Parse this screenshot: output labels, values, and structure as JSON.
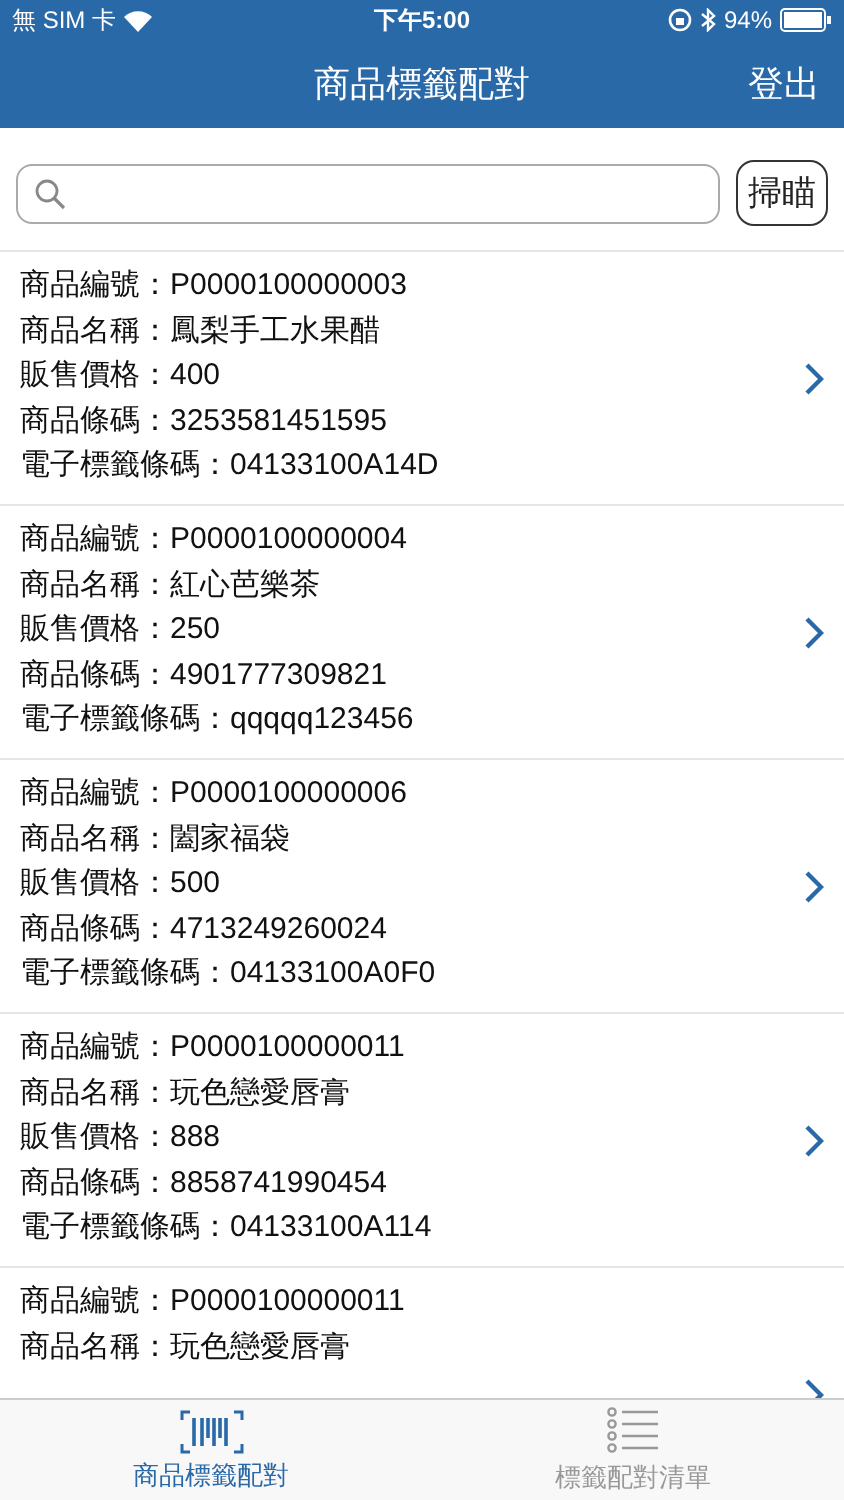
{
  "status_bar": {
    "carrier": "無 SIM 卡",
    "time": "下午5:00",
    "battery": "94%"
  },
  "nav": {
    "title": "商品標籤配對",
    "action": "登出"
  },
  "search": {
    "scan_button": "掃瞄"
  },
  "items": [
    {
      "lines": [
        "商品編號：P0000100000003",
        "商品名稱：鳳梨手工水果醋",
        "販售價格：400",
        "商品條碼：3253581451595",
        "電子標籤條碼：04133100A14D"
      ]
    },
    {
      "lines": [
        "商品編號：P0000100000004",
        "商品名稱：紅心芭樂茶",
        "販售價格：250",
        "商品條碼：4901777309821",
        "電子標籤條碼：qqqqq123456"
      ]
    },
    {
      "lines": [
        "商品編號：P0000100000006",
        "商品名稱：闔家福袋",
        "販售價格：500",
        "商品條碼：4713249260024",
        "電子標籤條碼：04133100A0F0"
      ]
    },
    {
      "lines": [
        "商品編號：P0000100000011",
        "商品名稱：玩色戀愛唇膏",
        "販售價格：888",
        "商品條碼：8858741990454",
        "電子標籤條碼：04133100A114"
      ]
    },
    {
      "lines": [
        "商品編號：P0000100000011",
        "商品名稱：玩色戀愛唇膏"
      ]
    }
  ],
  "tabs": [
    {
      "label": "商品標籤配對",
      "kind": "barcode",
      "selected": true
    },
    {
      "label": "標籤配對清單",
      "kind": "list",
      "selected": false
    }
  ]
}
